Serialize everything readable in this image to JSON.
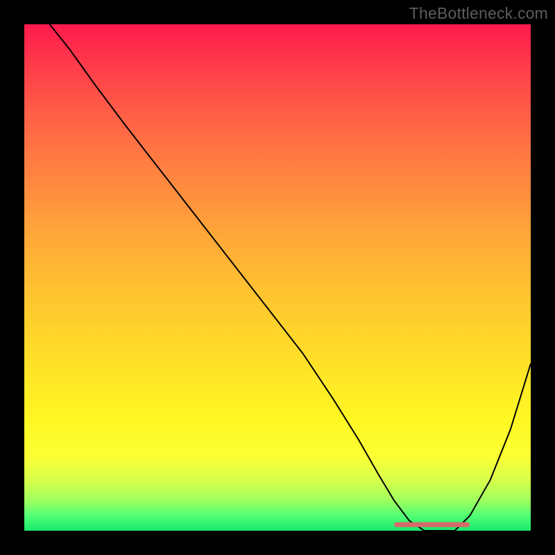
{
  "watermark": "TheBottleneck.com",
  "chart_data": {
    "type": "line",
    "title": "",
    "xlabel": "",
    "ylabel": "",
    "xlim": [
      0,
      100
    ],
    "ylim": [
      0,
      100
    ],
    "series": [
      {
        "name": "bottleneck-curve",
        "x": [
          5,
          9,
          14,
          20,
          27,
          34,
          41,
          48,
          55,
          61,
          66,
          70,
          73,
          76,
          79,
          82,
          85,
          88,
          92,
          96,
          100
        ],
        "y": [
          100,
          95,
          88,
          80,
          71,
          62,
          53,
          44,
          35,
          26,
          18,
          11,
          6,
          2,
          0,
          0,
          0,
          3,
          10,
          20,
          33
        ],
        "color": "#000000",
        "width": 2
      }
    ],
    "annotations": [
      {
        "name": "optimal-segment",
        "type": "segment",
        "x": [
          73.5,
          87.5
        ],
        "y": [
          1.2,
          1.2
        ],
        "color": "#d46a6a",
        "width": 7,
        "cap": "round"
      }
    ],
    "gradient_stops": [
      {
        "pos": 0,
        "color": "#ff1a4d"
      },
      {
        "pos": 8,
        "color": "#ff3b4a"
      },
      {
        "pos": 18,
        "color": "#ff6047"
      },
      {
        "pos": 30,
        "color": "#ff8540"
      },
      {
        "pos": 42,
        "color": "#ffa838"
      },
      {
        "pos": 55,
        "color": "#ffc82f"
      },
      {
        "pos": 68,
        "color": "#ffe327"
      },
      {
        "pos": 78,
        "color": "#fff723"
      },
      {
        "pos": 85,
        "color": "#fcff32"
      },
      {
        "pos": 90,
        "color": "#d8ff4a"
      },
      {
        "pos": 94,
        "color": "#9fff5e"
      },
      {
        "pos": 97,
        "color": "#52ff74"
      },
      {
        "pos": 100,
        "color": "#17e86e"
      }
    ]
  }
}
